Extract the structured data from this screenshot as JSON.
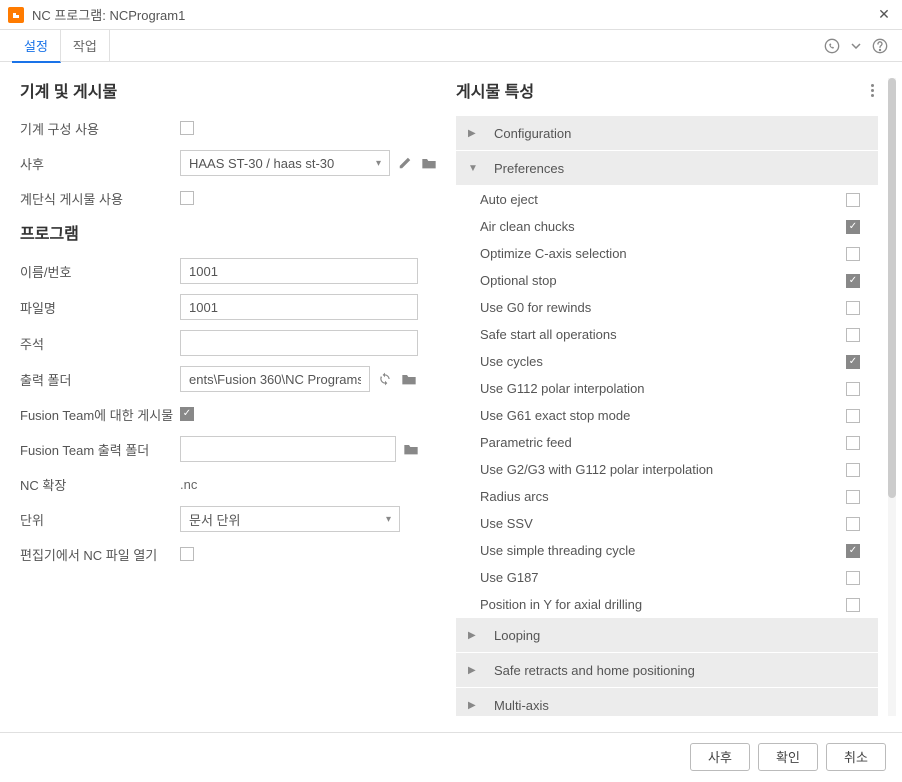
{
  "window": {
    "title": "NC 프로그램: NCProgram1"
  },
  "tabs": {
    "settings": "설정",
    "operations": "작업"
  },
  "left": {
    "section_machine": "기계 및 게시물",
    "use_machine_config": {
      "label": "기계 구성 사용",
      "checked": false
    },
    "post": {
      "label": "사후",
      "value": "HAAS ST-30 / haas st-30"
    },
    "cascading_post": {
      "label": "계단식 게시물 사용",
      "checked": false
    },
    "section_program": "프로그램",
    "name_number": {
      "label": "이름/번호",
      "value": "1001"
    },
    "file_name": {
      "label": "파일명",
      "value": "1001"
    },
    "comment": {
      "label": "주석",
      "value": ""
    },
    "output_folder": {
      "label": "출력 폴더",
      "value": "ents\\Fusion 360\\NC Programs"
    },
    "post_to_team": {
      "label": "Fusion Team에 대한 게시물",
      "checked": true
    },
    "team_output_folder": {
      "label": "Fusion Team 출력 폴더",
      "value": ""
    },
    "nc_extension": {
      "label": "NC 확장",
      "value": ".nc"
    },
    "unit": {
      "label": "단위",
      "value": "문서 단위"
    },
    "open_in_editor": {
      "label": "편집기에서 NC 파일 열기",
      "checked": false
    }
  },
  "right": {
    "header": "게시물 특성",
    "groups": {
      "configuration": "Configuration",
      "preferences": "Preferences",
      "looping": "Looping",
      "safe_retracts": "Safe retracts and home positioning",
      "multi_axis": "Multi-axis"
    },
    "prefs": [
      {
        "label": "Auto eject",
        "checked": false
      },
      {
        "label": "Air clean chucks",
        "checked": true
      },
      {
        "label": "Optimize C-axis selection",
        "checked": false
      },
      {
        "label": "Optional stop",
        "checked": true
      },
      {
        "label": "Use G0 for rewinds",
        "checked": false
      },
      {
        "label": "Safe start all operations",
        "checked": false
      },
      {
        "label": "Use cycles",
        "checked": true
      },
      {
        "label": "Use G112 polar interpolation",
        "checked": false
      },
      {
        "label": "Use G61 exact stop mode",
        "checked": false
      },
      {
        "label": "Parametric feed",
        "checked": false
      },
      {
        "label": "Use G2/G3 with G112 polar interpolation",
        "checked": false
      },
      {
        "label": "Radius arcs",
        "checked": false
      },
      {
        "label": "Use SSV",
        "checked": false
      },
      {
        "label": "Use simple threading cycle",
        "checked": true
      },
      {
        "label": "Use G187",
        "checked": false
      },
      {
        "label": "Position in Y for axial drilling",
        "checked": false
      }
    ]
  },
  "footer": {
    "post": "사후",
    "ok": "확인",
    "cancel": "취소"
  }
}
